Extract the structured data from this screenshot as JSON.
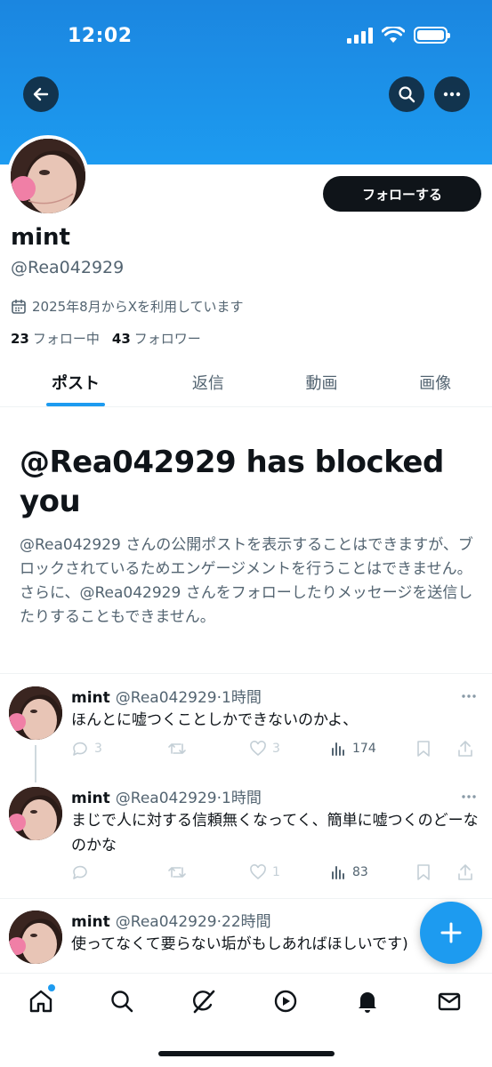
{
  "status": {
    "time": "12:02"
  },
  "profile": {
    "display_name": "mint",
    "handle": "@Rea042929",
    "joined": "2025年8月からXを利用しています",
    "following_count": "23",
    "following_label": "フォロー中",
    "followers_count": "43",
    "followers_label": "フォロワー",
    "follow_button": "フォローする"
  },
  "tabs": [
    {
      "label": "ポスト",
      "active": true
    },
    {
      "label": "返信",
      "active": false
    },
    {
      "label": "動画",
      "active": false
    },
    {
      "label": "画像",
      "active": false
    }
  ],
  "blocked": {
    "title": "@Rea042929 has blocked you",
    "description": "@Rea042929 さんの公開ポストを表示することはできますが、ブロックされているためエンゲージメントを行うことはできません。さらに、@Rea042929 さんをフォローしたりメッセージを送信したりすることもできません。"
  },
  "posts": [
    {
      "name": "mint",
      "meta": "@Rea042929·1時間",
      "text": "ほんとに嘘つくことしかできないのかよ、",
      "replies": "3",
      "reposts": "",
      "likes": "3",
      "views": "174"
    },
    {
      "name": "mint",
      "meta": "@Rea042929·1時間",
      "text": "まじで人に対する信頼無くなってく、簡単に嘘つくのどーなのかな",
      "replies": "",
      "reposts": "",
      "likes": "1",
      "views": "83"
    },
    {
      "name": "mint",
      "meta": "@Rea042929·22時間",
      "text": "使ってなくて要らない垢がもしあればほしいです)",
      "replies": "",
      "reposts": "",
      "likes": "",
      "views": ""
    }
  ],
  "icons": {
    "back": "arrow-left-icon",
    "search": "search-icon",
    "more": "more-horizontal-icon",
    "calendar": "calendar-icon",
    "compose": "plus-icon",
    "nav": [
      "home-icon",
      "search-icon",
      "grok-icon",
      "play-icon",
      "bell-icon",
      "mail-icon"
    ]
  },
  "colors": {
    "accent": "#1d9bf0",
    "text": "#0f1419",
    "secondary": "#536471"
  }
}
